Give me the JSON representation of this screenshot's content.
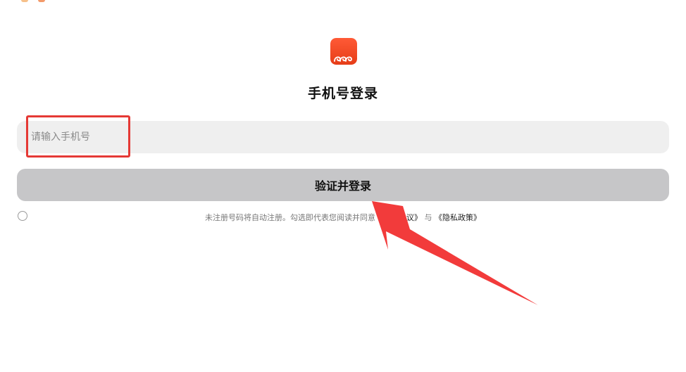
{
  "header": {
    "title": "手机号登录"
  },
  "login_form": {
    "phone_placeholder": "请输入手机号",
    "phone_value": "",
    "submit_label": "验证并登录"
  },
  "agreement": {
    "prefix": "未注册号码将自动注册。勾选即代表您阅读并同意",
    "user_agreement": "《用户协议》",
    "conjunction": "与",
    "privacy_policy": "《隐私政策》"
  },
  "colors": {
    "brand": "#f0471f",
    "input_bg": "#efefef",
    "button_bg": "#c6c6c8",
    "annotation": "#e53935"
  },
  "icons": {
    "app_logo": "app-logo-icon",
    "annotation_arrow": "arrow-annotation"
  }
}
